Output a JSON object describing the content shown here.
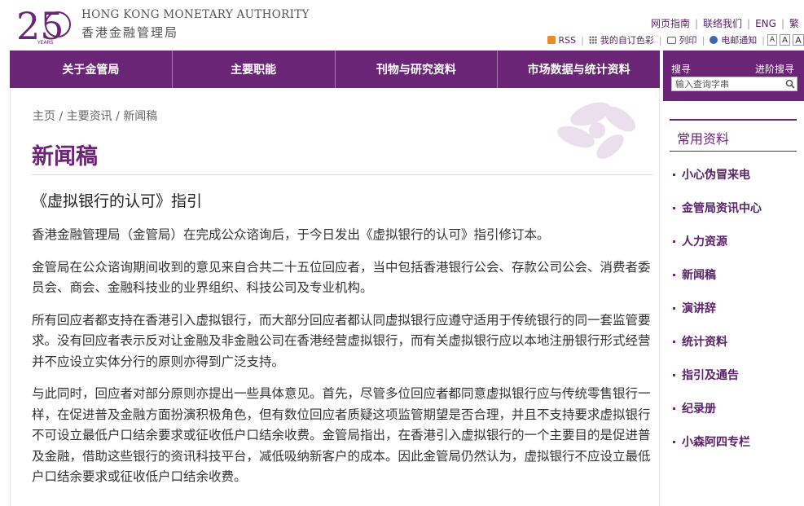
{
  "header": {
    "org_en": "HONG KONG MONETARY AUTHORITY",
    "org_zh": "香港金融管理局",
    "logo_number": "25",
    "logo_years": "YEARS",
    "top_links": [
      "网页指南",
      "联络我们",
      "ENG",
      "繁"
    ],
    "tools": [
      "RSS",
      "我的自订色彩",
      "列印",
      "电邮通知"
    ],
    "font_sizes": [
      "A",
      "A",
      "A"
    ]
  },
  "nav": {
    "items": [
      "关于金管局",
      "主要职能",
      "刊物与研究资料",
      "市场数据与统计资料"
    ]
  },
  "search": {
    "title": "搜寻",
    "advanced": "进阶搜寻",
    "placeholder": "输入查询字串"
  },
  "main": {
    "breadcrumb": [
      "主页",
      "主要资讯",
      "新闻稿"
    ],
    "breadcrumb_sep": " / ",
    "page_title": "新闻稿",
    "article_title": "《虚拟银行的认可》指引",
    "paragraphs": [
      "香港金融管理局（金管局）在完成公众谘询后，于今日发出《虚拟银行的认可》指引修订本。",
      "金管局在公众谘询期间收到的意见来自合共二十五位回应者，当中包括香港银行公会、存款公司公会、消费者委员会、商会、金融科技业的业界组织、科技公司及专业机构。",
      "所有回应者都支持在香港引入虚拟银行，而大部分回应者都认同虚拟银行应遵守适用于传统银行的同一套监管要求。没有回应者表示反对让金融及非金融公司在香港经营虚拟银行，而有关虚拟银行应以本地注册银行形式经营并不应设立实体分行的原则亦得到广泛支持。",
      "与此同时，回应者对部分原则亦提出一些具体意见。首先，尽管多位回应者都同意虚拟银行应与传统零售银行一样，在促进普及金融方面扮演积极角色，但有数位回应者质疑这项监管期望是否合理，并且不支持要求虚拟银行不可设立最低户口结余要求或征收低户口结余收费。金管局指出，在香港引入虚拟银行的一个主要目的是促进普及金融，借助这些银行的资讯科技平台，减低吸纳新客户的成本。因此金管局仍然认为，虚拟银行不应设立最低户口结余要求或征收低户口结余收费。"
    ]
  },
  "sidebar": {
    "heading": "常用资料",
    "items": [
      "小心伪冒来电",
      "金管局资讯中心",
      "人力资源",
      "新闻稿",
      "演讲辞",
      "统计资料",
      "指引及通告",
      "纪录册",
      "小森阿四专栏"
    ]
  },
  "colors": {
    "brand_purple": "#6b2577",
    "link_purple": "#5b2369",
    "rss_orange": "#f08a24"
  }
}
